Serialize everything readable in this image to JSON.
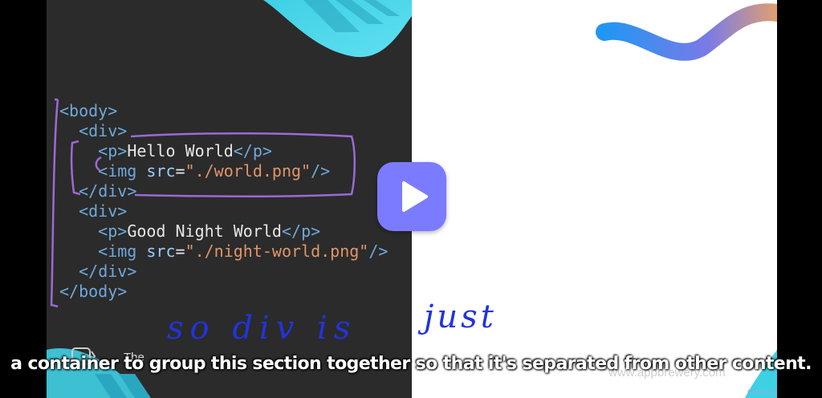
{
  "code": {
    "lines": [
      {
        "indent": "",
        "open": "<",
        "tag": "body",
        "close": ">"
      },
      {
        "indent": "  ",
        "open": "<",
        "tag": "div",
        "close": ">"
      },
      {
        "indent": "    ",
        "open": "<",
        "tag": "p",
        "close": ">",
        "text": "Hello World",
        "end_open": "</",
        "end_tag": "p",
        "end_close": ">"
      },
      {
        "indent": "    ",
        "open": "<",
        "tag": "img",
        "attr": " src",
        "eq": "=",
        "value": "\"./world.png\"",
        "self": "/>"
      },
      {
        "indent": "  ",
        "open": "</",
        "tag": "div",
        "close": ">"
      },
      {
        "indent": "  ",
        "open": "<",
        "tag": "div",
        "close": ">"
      },
      {
        "indent": "    ",
        "open": "<",
        "tag": "p",
        "close": ">",
        "text": "Good Night World",
        "end_open": "</",
        "end_tag": "p",
        "end_close": ">"
      },
      {
        "indent": "    ",
        "open": "<",
        "tag": "img",
        "attr": " src",
        "eq": "=",
        "value": "\"./night-world.png\"",
        "self": "/>"
      },
      {
        "indent": "  ",
        "open": "</",
        "tag": "div",
        "close": ">"
      },
      {
        "indent": "",
        "open": "</",
        "tag": "body",
        "close": ">"
      }
    ]
  },
  "handwriting": {
    "text_left": "so div is",
    "text_right": "just"
  },
  "brand": {
    "text": "The"
  },
  "watermark": "www.appbrewery.com",
  "bottom_badge": "Ostrauss",
  "subtitle": "a container to group this section together so that it's separated from other content.",
  "icons": {
    "play": "play-icon"
  },
  "colors": {
    "play_button": "#7b7bff",
    "annotation_purple": "#9a6ad6",
    "handwriting_blue": "#2233dd",
    "blob_cyan": "#3fd0e4"
  }
}
